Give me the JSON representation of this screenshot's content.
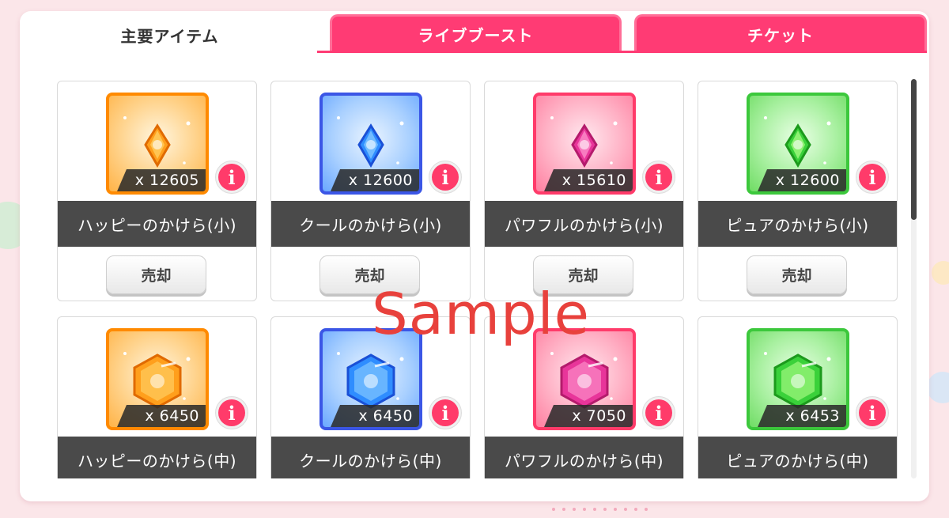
{
  "tabs": [
    {
      "label": "主要アイテム",
      "active": true
    },
    {
      "label": "ライブブースト",
      "active": false
    },
    {
      "label": "チケット",
      "active": false
    }
  ],
  "items": [
    {
      "name": "ハッピーのかけら(小)",
      "quantity": "x 12605",
      "color": "orange",
      "size": "small",
      "sell_label": "売却"
    },
    {
      "name": "クールのかけら(小)",
      "quantity": "x 12600",
      "color": "blue",
      "size": "small",
      "sell_label": "売却"
    },
    {
      "name": "パワフルのかけら(小)",
      "quantity": "x 15610",
      "color": "pink",
      "size": "small",
      "sell_label": "売却"
    },
    {
      "name": "ピュアのかけら(小)",
      "quantity": "x 12600",
      "color": "green",
      "size": "small",
      "sell_label": "売却"
    },
    {
      "name": "ハッピーのかけら(中)",
      "quantity": "x 6450",
      "color": "orange",
      "size": "medium"
    },
    {
      "name": "クールのかけら(中)",
      "quantity": "x 6450",
      "color": "blue",
      "size": "medium"
    },
    {
      "name": "パワフルのかけら(中)",
      "quantity": "x 7050",
      "color": "pink",
      "size": "medium"
    },
    {
      "name": "ピュアのかけら(中)",
      "quantity": "x 6453",
      "color": "green",
      "size": "medium"
    }
  ],
  "info_button_label": "i",
  "watermark": "Sample",
  "colors": {
    "tab_pink": "#ff3b74",
    "orange": "#ff8a00",
    "blue": "#3b56e6",
    "pink": "#ff3b6a",
    "green": "#3cc83c",
    "name_bar": "#4a4a4a"
  }
}
